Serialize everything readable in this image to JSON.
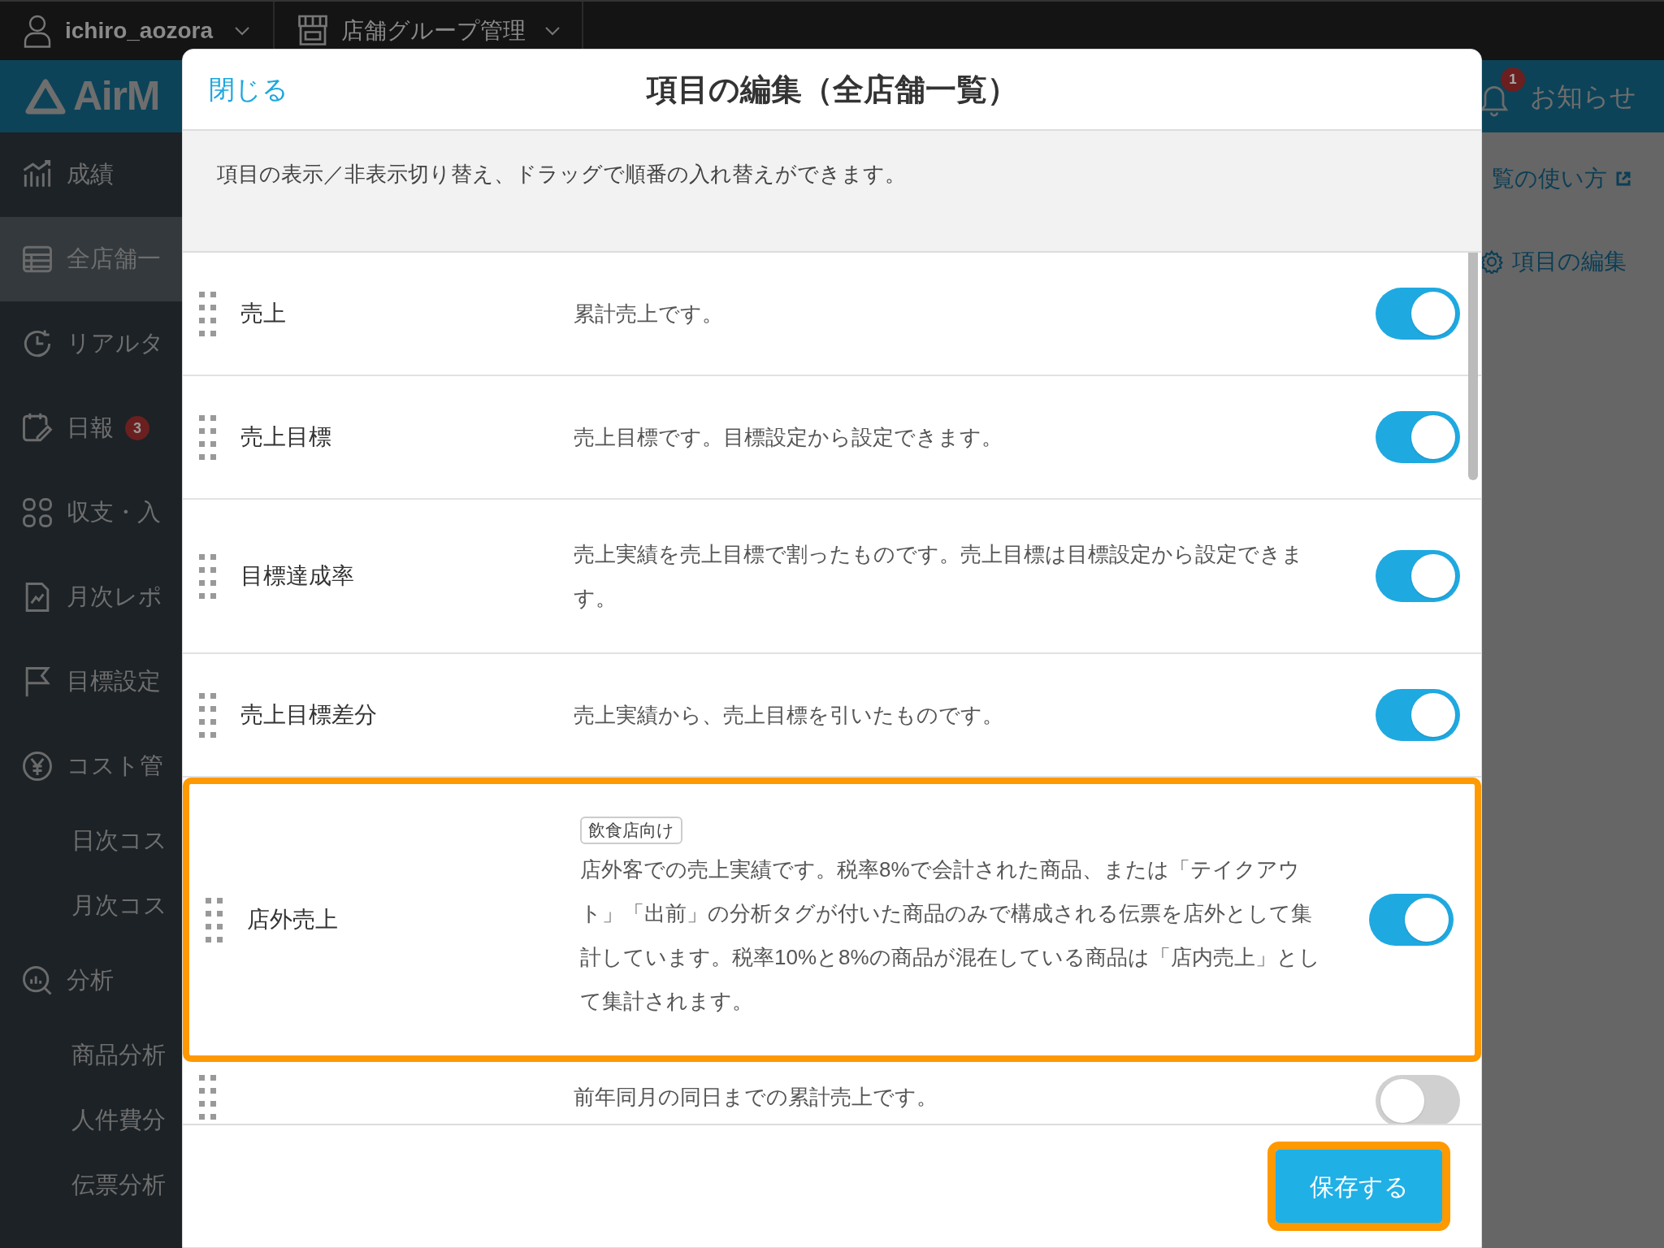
{
  "top_bar": {
    "user": "ichiro_aozora",
    "store_group": "店舗グループ管理"
  },
  "header": {
    "logo": "AirM",
    "notification_badge": "1",
    "notifications_label": "お知らせ"
  },
  "sidebar": {
    "items": [
      {
        "kind": "main",
        "label": "成績",
        "selected": false
      },
      {
        "kind": "main",
        "label": "全店舗一",
        "selected": true
      },
      {
        "kind": "main",
        "label": "リアルタ",
        "selected": false
      },
      {
        "kind": "main",
        "label": "日報",
        "selected": false,
        "badge": "3"
      },
      {
        "kind": "main",
        "label": "収支・入",
        "selected": false
      },
      {
        "kind": "main",
        "label": "月次レポ",
        "selected": false
      },
      {
        "kind": "main",
        "label": "目標設定",
        "selected": false
      },
      {
        "kind": "main",
        "label": "コスト管",
        "selected": false
      },
      {
        "kind": "sub",
        "label": "日次コス",
        "selected": false
      },
      {
        "kind": "sub",
        "label": "月次コス",
        "selected": false
      },
      {
        "kind": "main",
        "label": "分析",
        "selected": false
      },
      {
        "kind": "sub",
        "label": "商品分析",
        "selected": false
      },
      {
        "kind": "sub",
        "label": "人件費分",
        "selected": false
      },
      {
        "kind": "sub",
        "label": "伝票分析",
        "selected": false
      }
    ]
  },
  "content": {
    "help_link": "覧の使い方",
    "edit_link": "項目の編集"
  },
  "modal": {
    "close": "閉じる",
    "title": "項目の編集（全店舗一覧）",
    "description": "項目の表示／非表示切り替え、ドラッグで順番の入れ替えができます。",
    "items": [
      {
        "name": "売上",
        "description": "累計売上です。",
        "on": true,
        "highlighted": false
      },
      {
        "name": "売上目標",
        "description": "売上目標です。目標設定から設定できます。",
        "on": true,
        "highlighted": false
      },
      {
        "name": "目標達成率",
        "description": "売上実績を売上目標で割ったものです。売上目標は目標設定から設定できます。",
        "on": true,
        "highlighted": false
      },
      {
        "name": "売上目標差分",
        "description": "売上実績から、売上目標を引いたものです。",
        "on": true,
        "highlighted": false
      },
      {
        "name": "店外売上",
        "tag": "飲食店向け",
        "description": "店外客での売上実績です。税率8%で会計された商品、または「テイクアウト」「出前」の分析タグが付いた商品のみで構成される伝票を店外として集計しています。税率10%と8%の商品が混在している商品は「店内売上」として集計されます。",
        "on": true,
        "highlighted": true
      },
      {
        "description": "前年同月の同日までの累計売上です。",
        "on": false,
        "highlighted": false
      }
    ],
    "save": "保存する",
    "save_highlighted": true
  }
}
